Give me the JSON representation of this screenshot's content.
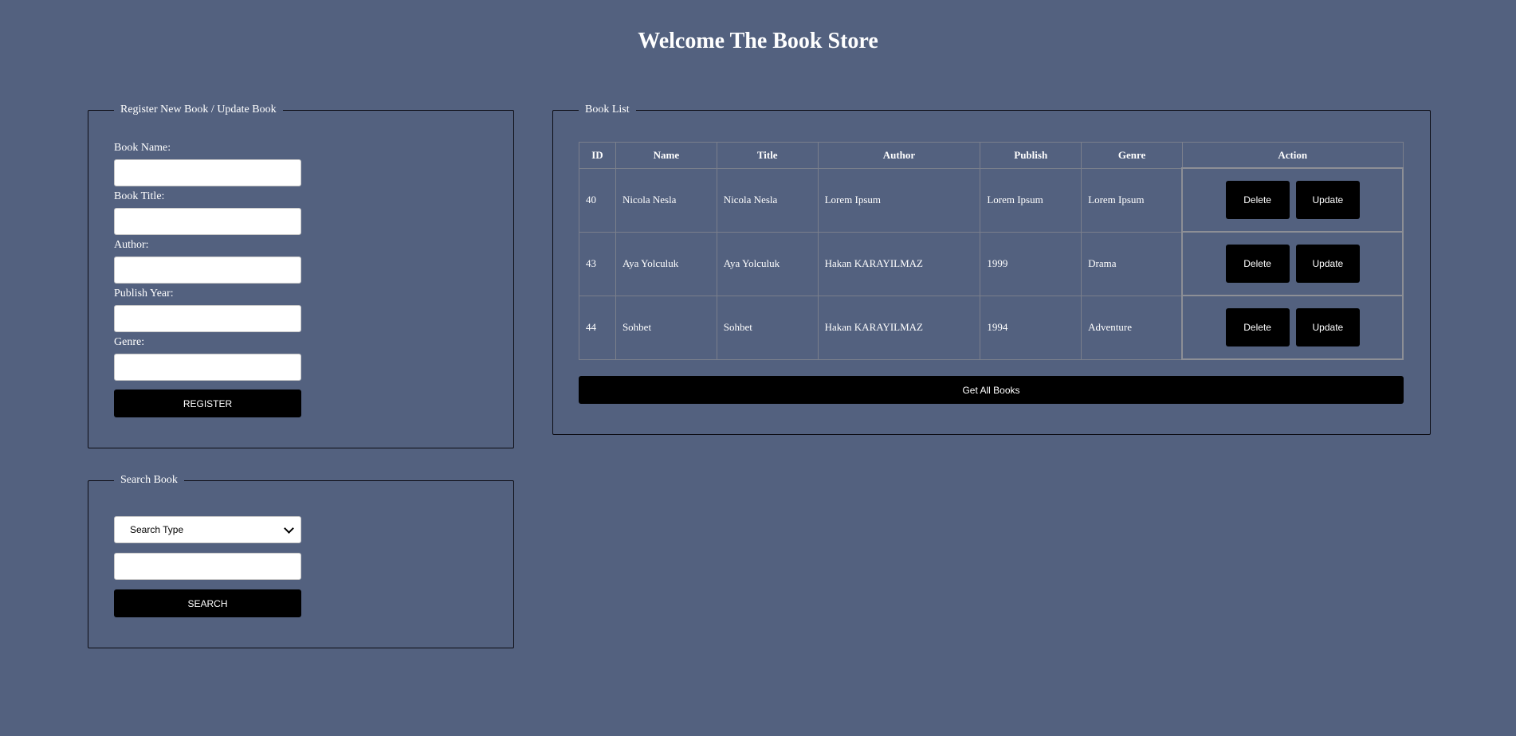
{
  "header": {
    "title": "Welcome The Book Store"
  },
  "register": {
    "legend": "Register New Book / Update Book",
    "book_name_label": "Book Name:",
    "book_name_value": "",
    "book_title_label": "Book Title:",
    "book_title_value": "",
    "author_label": "Author:",
    "author_value": "",
    "publish_year_label": "Publish Year:",
    "publish_year_value": "",
    "genre_label": "Genre:",
    "genre_value": "",
    "register_button": "REGISTER"
  },
  "search": {
    "legend": "Search Book",
    "search_type_selected": "Search Type",
    "query_value": "",
    "search_button": "SEARCH"
  },
  "book_list": {
    "legend": "Book List",
    "columns": [
      "ID",
      "Name",
      "Title",
      "Author",
      "Publish",
      "Genre",
      "Action"
    ],
    "rows": [
      {
        "id": "40",
        "name": "Nicola Nesla",
        "title": "Nicola Nesla",
        "author": "Lorem Ipsum",
        "publish": "Lorem Ipsum",
        "genre": "Lorem Ipsum"
      },
      {
        "id": "43",
        "name": "Aya Yolculuk",
        "title": "Aya Yolculuk",
        "author": "Hakan KARAYILMAZ",
        "publish": "1999",
        "genre": "Drama"
      },
      {
        "id": "44",
        "name": "Sohbet",
        "title": "Sohbet",
        "author": "Hakan KARAYILMAZ",
        "publish": "1994",
        "genre": "Adventure"
      }
    ],
    "delete_label": "Delete",
    "update_label": "Update",
    "get_all_button": "Get All Books"
  },
  "colors": {
    "background": "#53617f",
    "button": "#000000",
    "text": "#ffffff"
  },
  "icons": {
    "select_arrow": "chevron-down-icon"
  }
}
